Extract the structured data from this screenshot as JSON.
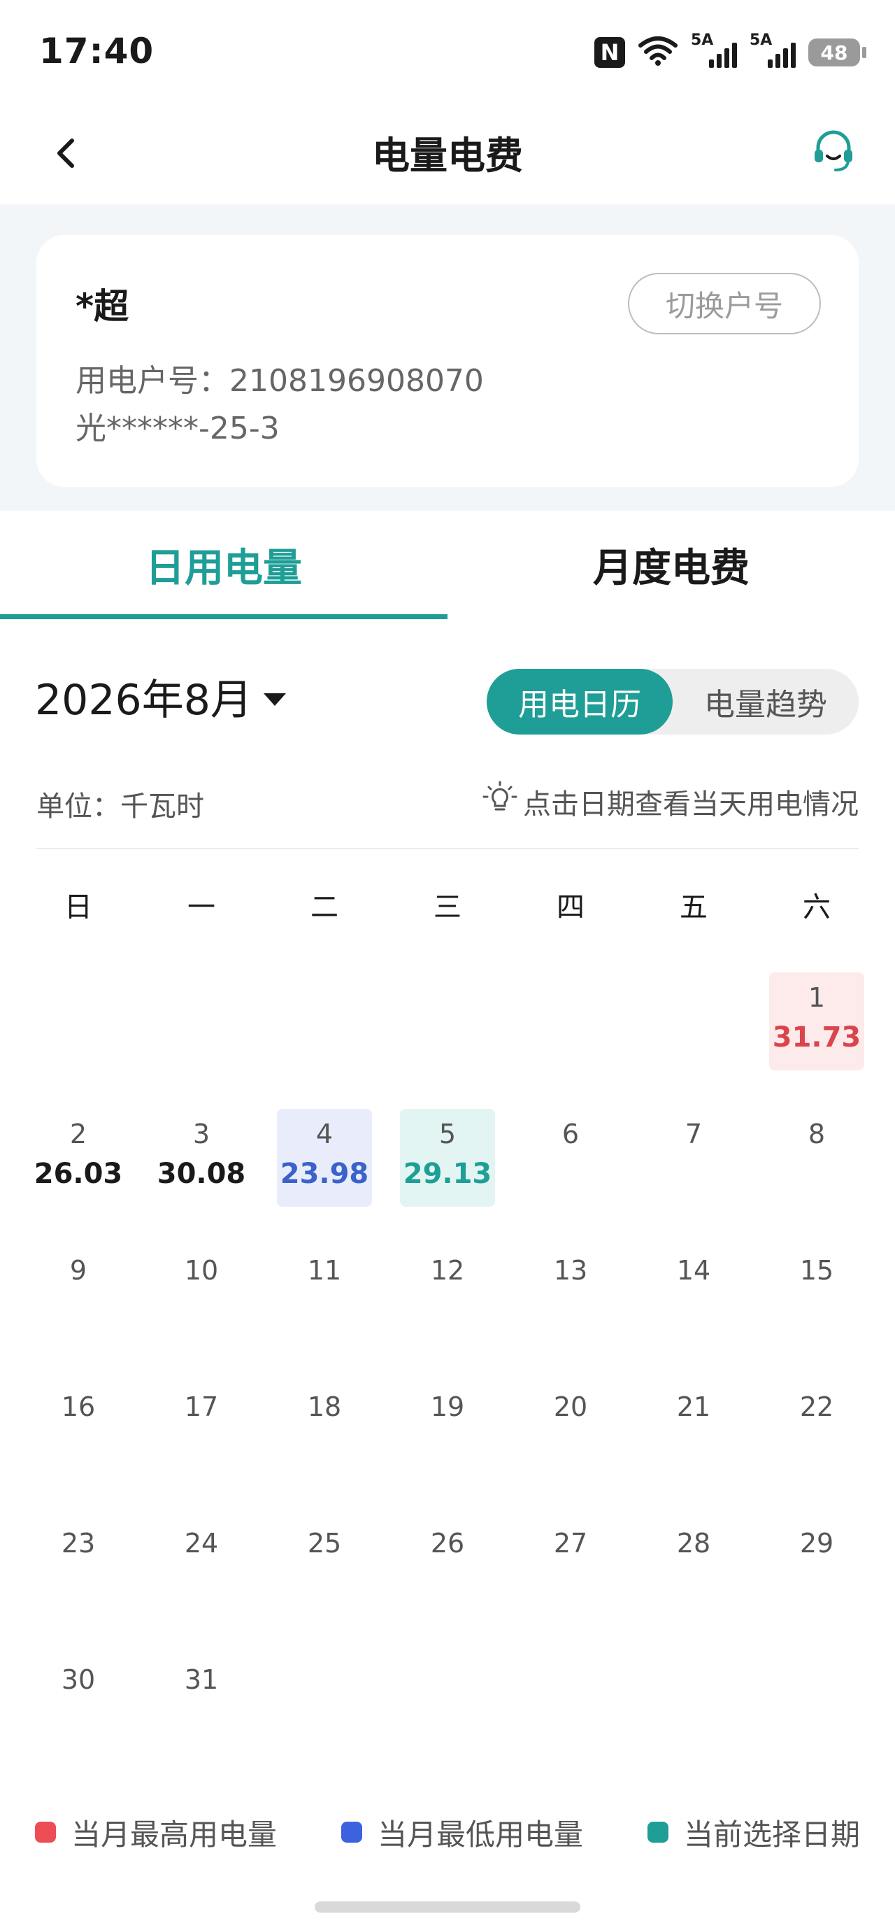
{
  "status_bar": {
    "time": "17:40",
    "nfc": "N",
    "signal1_label": "5A",
    "signal2_label": "5A",
    "battery": "48"
  },
  "header": {
    "title": "电量电费",
    "back_icon": "chevron-left-icon",
    "support_icon": "headset-icon"
  },
  "account": {
    "name": "*超",
    "switch_label": "切换户号",
    "number_line": "用电户号：2108196908070",
    "address_line": "光******-25-3"
  },
  "tabs": [
    {
      "label": "日用电量",
      "active": true
    },
    {
      "label": "月度电费",
      "active": false
    }
  ],
  "toolbar": {
    "month": "2026年8月",
    "view_calendar": "用电日历",
    "view_trend": "电量趋势"
  },
  "unit": "单位：千瓦时",
  "hint": "点击日期查看当天用电情况",
  "weekdays": [
    "日",
    "一",
    "二",
    "三",
    "四",
    "五",
    "六"
  ],
  "calendar": {
    "first_weekday": 6,
    "days_in_month": 31,
    "readings": {
      "1": {
        "value": "31.73",
        "mark": "high"
      },
      "2": {
        "value": "26.03"
      },
      "3": {
        "value": "30.08"
      },
      "4": {
        "value": "23.98",
        "mark": "low"
      },
      "5": {
        "value": "29.13",
        "mark": "selected"
      }
    }
  },
  "legend": [
    {
      "label": "当月最高用电量",
      "color": "#ef4d56"
    },
    {
      "label": "当月最低用电量",
      "color": "#3d62e0"
    },
    {
      "label": "当前选择日期",
      "color": "#1e9e96"
    }
  ]
}
